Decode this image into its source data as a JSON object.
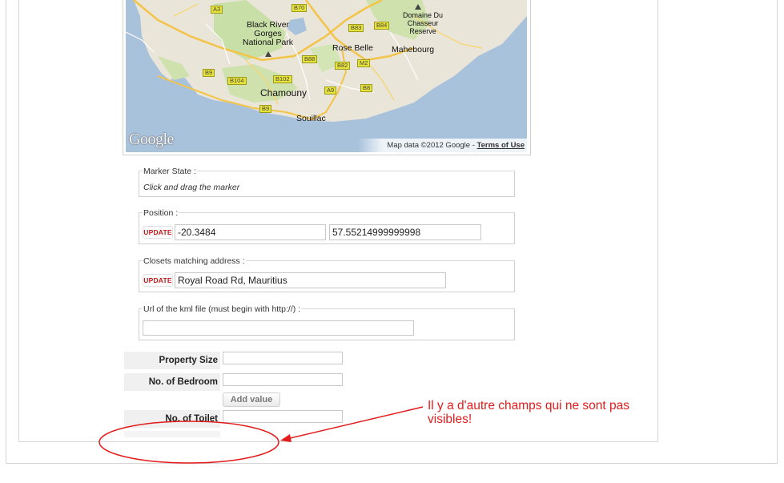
{
  "map": {
    "labels": {
      "black_river": "Black River\nGorges\nNational Park",
      "domaine": "Domaine Du\nChasseur\nReserve",
      "mahebourg": "Mahebourg",
      "rose_belle": "Rose Belle",
      "chamouny": "Chamouny",
      "souillac": "Souillac"
    },
    "roads": [
      "A3",
      "B70",
      "B83",
      "B84",
      "B88",
      "M2",
      "B82",
      "B9",
      "B104",
      "B102",
      "A9",
      "B8",
      "B9"
    ],
    "logo": "Google",
    "attribution": "Map data ©2012 Google - ",
    "terms": "Terms of Use"
  },
  "marker_state": {
    "legend": "Marker State :",
    "hint": "Click and drag the marker"
  },
  "position": {
    "legend": "Position :",
    "update_label": "UPDATE",
    "lat": "-20.3484",
    "lng": "57.55214999999998"
  },
  "address": {
    "legend": "Closets matching address :",
    "update_label": "UPDATE",
    "value": "Royal Road Rd, Mauritius"
  },
  "kml": {
    "legend": "Url of the kml file (must begin with http://) :",
    "value": ""
  },
  "properties": {
    "size_label": "Property Size",
    "bedroom_label": "No. of Bedroom",
    "add_value_label": "Add value",
    "toilet_label": "No. of Toilet"
  },
  "annotation": {
    "text": "Il y a d'autre champs qui ne sont pas visibles!",
    "color": "#e21b1b"
  }
}
